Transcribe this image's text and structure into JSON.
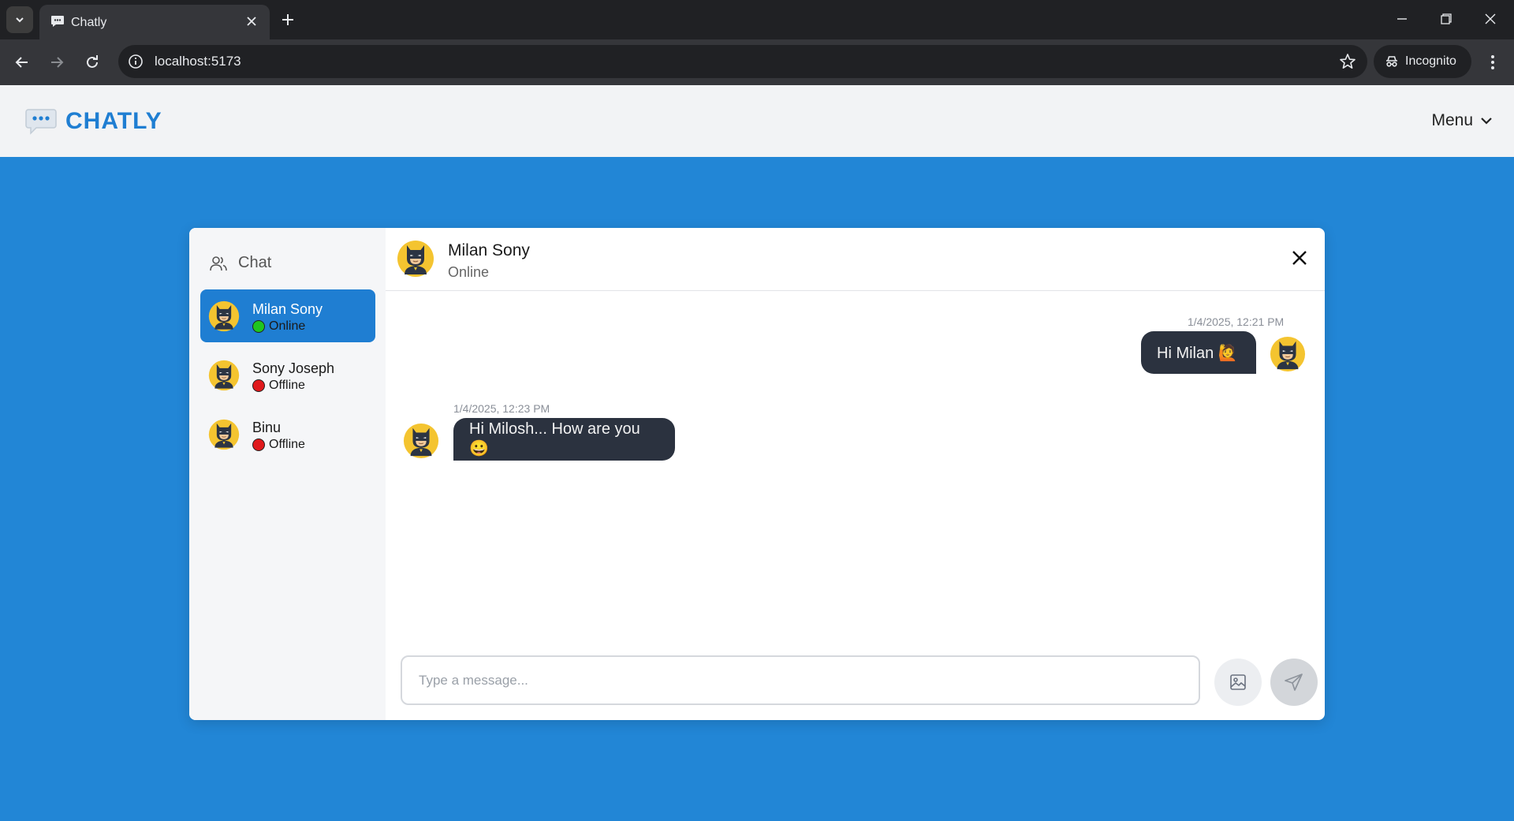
{
  "browser": {
    "tab_title": "Chatly",
    "url": "localhost:5173",
    "incognito_label": "Incognito"
  },
  "app": {
    "logo_text": "CHATLY",
    "menu_label": "Menu",
    "brand_color": "#1f7ed2",
    "background_color": "#2286d6"
  },
  "sidebar": {
    "title": "Chat",
    "contacts": [
      {
        "name": "Milan Sony",
        "status": "Online",
        "status_color": "#1fc51f",
        "active": true
      },
      {
        "name": "Sony Joseph",
        "status": "Offline",
        "status_color": "#e0191c",
        "active": false
      },
      {
        "name": "Binu",
        "status": "Offline",
        "status_color": "#e0191c",
        "active": false
      }
    ]
  },
  "chat": {
    "header_name": "Milan Sony",
    "header_status": "Online",
    "messages": [
      {
        "time": "1/4/2025, 12:21 PM",
        "text": "Hi Milan 🙋",
        "direction": "outgoing"
      },
      {
        "time": "1/4/2025, 12:23 PM",
        "text": "Hi Milosh... How are you😀",
        "direction": "incoming"
      }
    ],
    "input_placeholder": "Type a message..."
  }
}
